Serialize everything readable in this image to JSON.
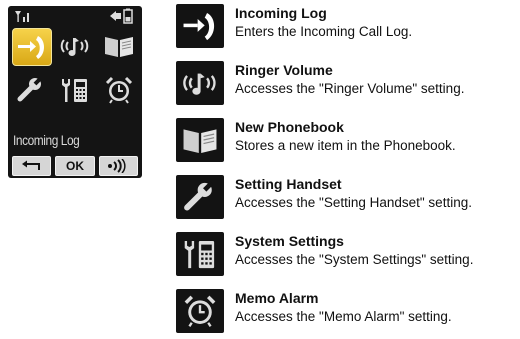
{
  "phone": {
    "selected_label": "Incoming Log",
    "icons": [
      {
        "name": "incoming-log-icon",
        "selected": true
      },
      {
        "name": "ringer-volume-icon",
        "selected": false
      },
      {
        "name": "new-phonebook-icon",
        "selected": false
      },
      {
        "name": "setting-handset-icon",
        "selected": false
      },
      {
        "name": "system-settings-icon",
        "selected": false
      },
      {
        "name": "memo-alarm-icon",
        "selected": false
      }
    ],
    "softkeys": {
      "back_icon": "back-arrow-icon",
      "ok_label": "OK",
      "volume_icon": "sound-waves-icon"
    },
    "colors": {
      "screen": "#141414",
      "highlight": "#f2c22e",
      "text": "#d9d9d9"
    }
  },
  "legend": {
    "items": [
      {
        "title": "Incoming Log",
        "description": "Enters the Incoming Call Log."
      },
      {
        "title": "Ringer Volume",
        "description": "Accesses the \"Ringer Volume\" setting."
      },
      {
        "title": "New Phonebook",
        "description": "Stores a new item in the Phonebook."
      },
      {
        "title": "Setting Handset",
        "description": "Accesses the \"Setting Handset\" setting."
      },
      {
        "title": "System Settings",
        "description": "Accesses the \"System Settings\" setting."
      },
      {
        "title": "Memo Alarm",
        "description": "Accesses the \"Memo Alarm\" setting."
      }
    ]
  }
}
